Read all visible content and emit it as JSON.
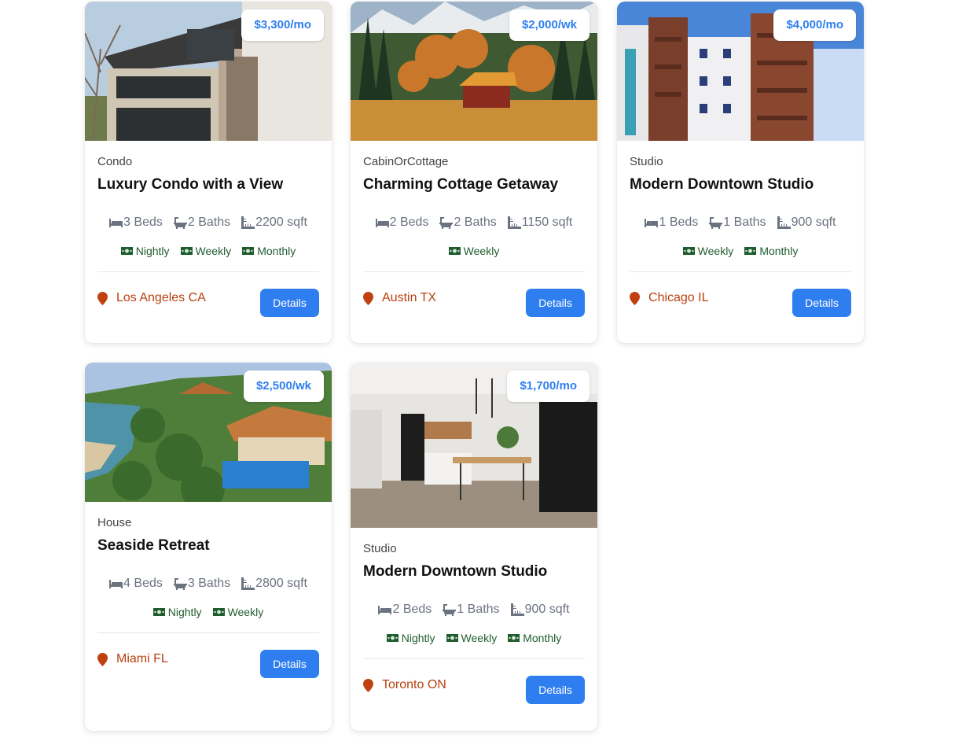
{
  "colors": {
    "accent": "#2f7ef0",
    "location": "#b8400f",
    "term": "#1f5d2e",
    "muted": "#6b7280"
  },
  "icons": {
    "beds": "bed-icon",
    "baths": "bathtub-icon",
    "area": "ruler-icon",
    "term": "money-icon",
    "location": "map-pin-icon"
  },
  "listings": [
    {
      "price": "$3,300/mo",
      "type": "Condo",
      "title": "Luxury Condo with a View",
      "beds": "3 Beds",
      "baths": "2 Baths",
      "area": "2200 sqft",
      "terms": [
        "Nightly",
        "Weekly",
        "Monthly"
      ],
      "location": "Los Angeles CA",
      "button": "Details"
    },
    {
      "price": "$2,000/wk",
      "type": "CabinOrCottage",
      "title": "Charming Cottage Getaway",
      "beds": "2 Beds",
      "baths": "2 Baths",
      "area": "1150 sqft",
      "terms": [
        "Weekly"
      ],
      "location": "Austin TX",
      "button": "Details"
    },
    {
      "price": "$4,000/mo",
      "type": "Studio",
      "title": "Modern Downtown Studio",
      "beds": "1 Beds",
      "baths": "1 Baths",
      "area": "900 sqft",
      "terms": [
        "Weekly",
        "Monthly"
      ],
      "location": "Chicago IL",
      "button": "Details"
    },
    {
      "price": "$2,500/wk",
      "type": "House",
      "title": "Seaside Retreat",
      "beds": "4 Beds",
      "baths": "3 Baths",
      "area": "2800 sqft",
      "terms": [
        "Nightly",
        "Weekly"
      ],
      "location": "Miami FL",
      "button": "Details"
    },
    {
      "price": "$1,700/mo",
      "type": "Studio",
      "title": "Modern Downtown Studio",
      "beds": "2 Beds",
      "baths": "1 Baths",
      "area": "900 sqft",
      "terms": [
        "Nightly",
        "Weekly",
        "Monthly"
      ],
      "location": "Toronto ON",
      "button": "Details"
    }
  ]
}
